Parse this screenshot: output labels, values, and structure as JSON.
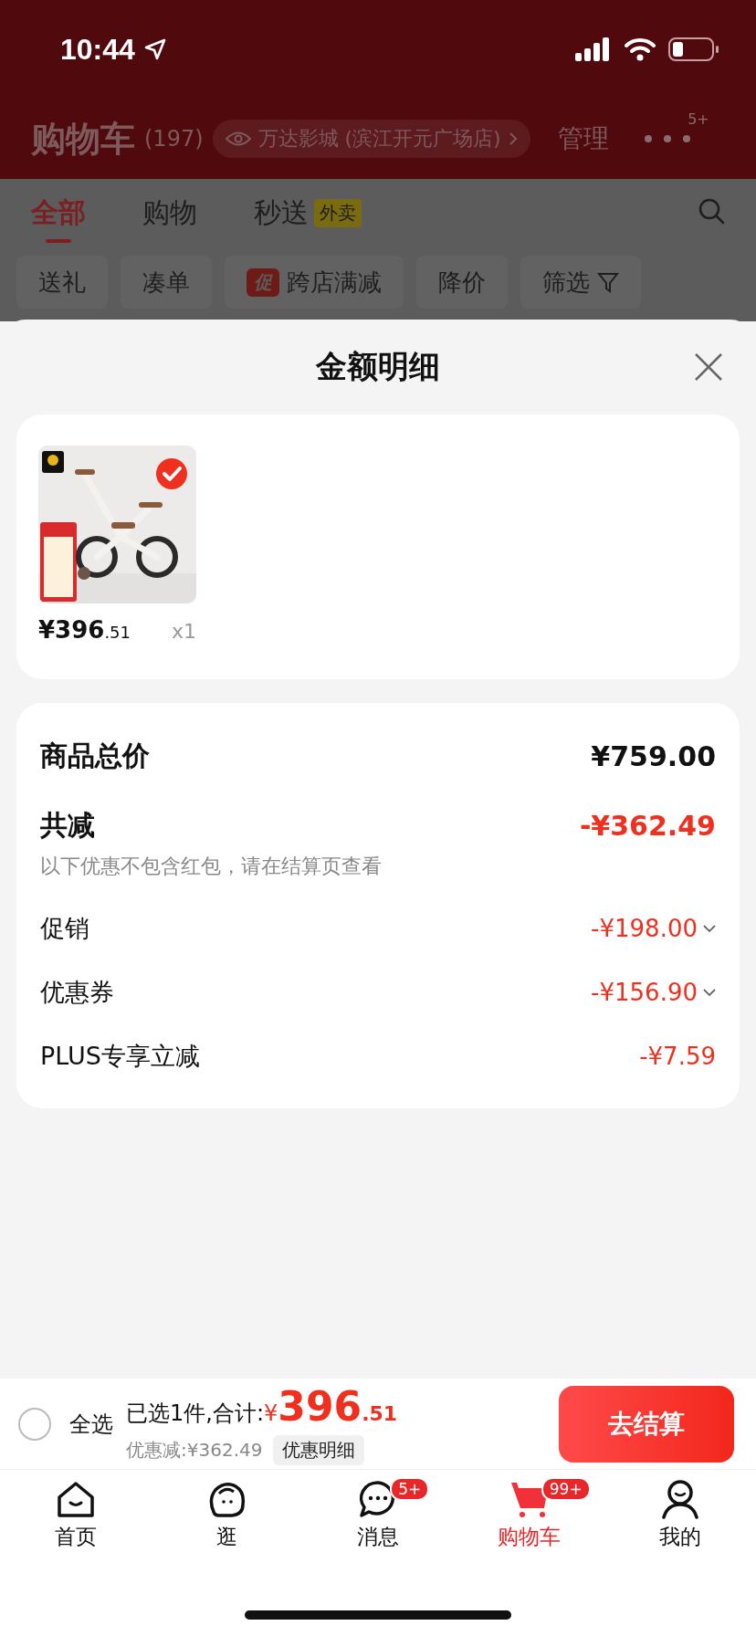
{
  "status_bar": {
    "time": "10:44"
  },
  "header": {
    "title": "购物车",
    "count": "(197)",
    "store": "万达影城 (滨江开元广场店)",
    "manage": "管理",
    "more_badge": "5+"
  },
  "tabs": [
    {
      "label": "全部",
      "selected": true
    },
    {
      "label": "购物",
      "selected": false
    },
    {
      "label": "秒送",
      "selected": false,
      "badge": "外卖"
    }
  ],
  "filter_chips": [
    {
      "label": "送礼"
    },
    {
      "label": "凑单"
    },
    {
      "label": "跨店满减",
      "tag": "促"
    },
    {
      "label": "降价"
    },
    {
      "label": "筛选",
      "kind": "filter"
    }
  ],
  "sheet": {
    "title": "金额明细",
    "product": {
      "checked": true,
      "currency": "¥",
      "price": "396",
      "decimals": ".51",
      "quantity": "x1"
    },
    "summary": [
      {
        "kind": "total",
        "label": "商品总价",
        "value": "¥759.00"
      },
      {
        "kind": "discount",
        "label": "共减",
        "value": "-¥362.49"
      },
      {
        "kind": "note",
        "label": "以下优惠不包含红包，请在结算页查看"
      },
      {
        "kind": "item",
        "label": "促销",
        "value": "-¥198.00",
        "expandable": true
      },
      {
        "kind": "item",
        "label": "优惠券",
        "value": "-¥156.90",
        "expandable": true
      },
      {
        "kind": "item",
        "label": "PLUS专享立减",
        "value": "-¥7.59",
        "expandable": false
      }
    ]
  },
  "bottom_bar": {
    "select_all": {
      "label": "全选",
      "checked": false
    },
    "selected_text": "已选1件,合计:",
    "currency": "¥",
    "total": "396",
    "decimals": ".51",
    "discount_text": "优惠减:¥362.49",
    "detail_button": "优惠明细",
    "checkout": "去结算"
  },
  "nav": [
    {
      "label": "首页",
      "selected": false
    },
    {
      "label": "逛",
      "selected": false
    },
    {
      "label": "消息",
      "selected": false,
      "badge": "5+"
    },
    {
      "label": "购物车",
      "selected": true,
      "badge": "99+"
    },
    {
      "label": "我的",
      "selected": false
    }
  ]
}
